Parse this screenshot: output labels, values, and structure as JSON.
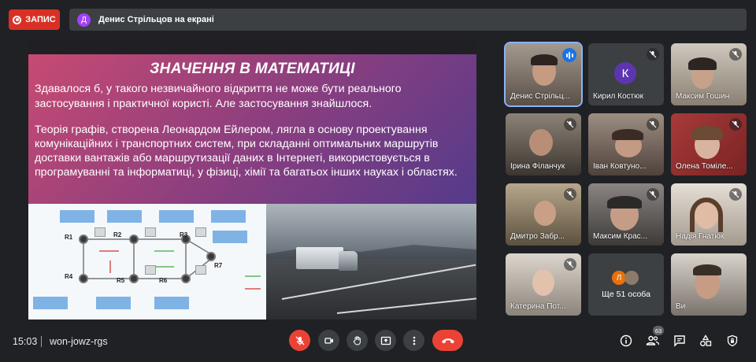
{
  "recording": {
    "label": "ЗАПИС"
  },
  "presenter_bar": {
    "avatar_letter": "Д",
    "text": "Денис Стрільцов на екрані"
  },
  "slide": {
    "title": "ЗНАЧЕННЯ В МАТЕМАТИЦІ",
    "paragraph1": "Здавалося б, у такого незвичайного відкриття не може бути  реального застосування і практичної користі. Але застосування знайшлося.",
    "paragraph2": "Теорія графів, створена Леонардом Ейлером, лягла в основу проектування комунікаційних і транспортних систем, при складанні оптимальних маршрутів доставки вантажів або маршрутизації даних в Інтернеті, використовується в програмуванні та інформатиці, у фізиці, хімії та багатьох інших науках і областях.",
    "diagram": {
      "routers": [
        "R1",
        "R2",
        "R3",
        "R4",
        "R5",
        "R6",
        "R7"
      ]
    }
  },
  "participants": [
    {
      "name": "Денис Стрільц...",
      "speaking": true
    },
    {
      "name": "Кирил Костюк",
      "avatar": "К"
    },
    {
      "name": "Максим Гошин"
    },
    {
      "name": "Ірина Філанчук"
    },
    {
      "name": "Іван Ковтуно..."
    },
    {
      "name": "Олена Томіле..."
    },
    {
      "name": "Дмитро Забр..."
    },
    {
      "name": "Максим Крас..."
    },
    {
      "name": "Надія Гнатюк"
    },
    {
      "name": "Катерина Пот..."
    },
    {
      "name": "Ще 51 особа",
      "avatar": "Л"
    },
    {
      "name": "Ви"
    }
  ],
  "bottom_bar": {
    "time": "15:03",
    "meeting_code": "won-jowz-rgs",
    "participant_count": "63"
  },
  "colors": {
    "accent_red": "#ea4335",
    "accent_blue": "#1a73e8",
    "background": "#202124"
  }
}
